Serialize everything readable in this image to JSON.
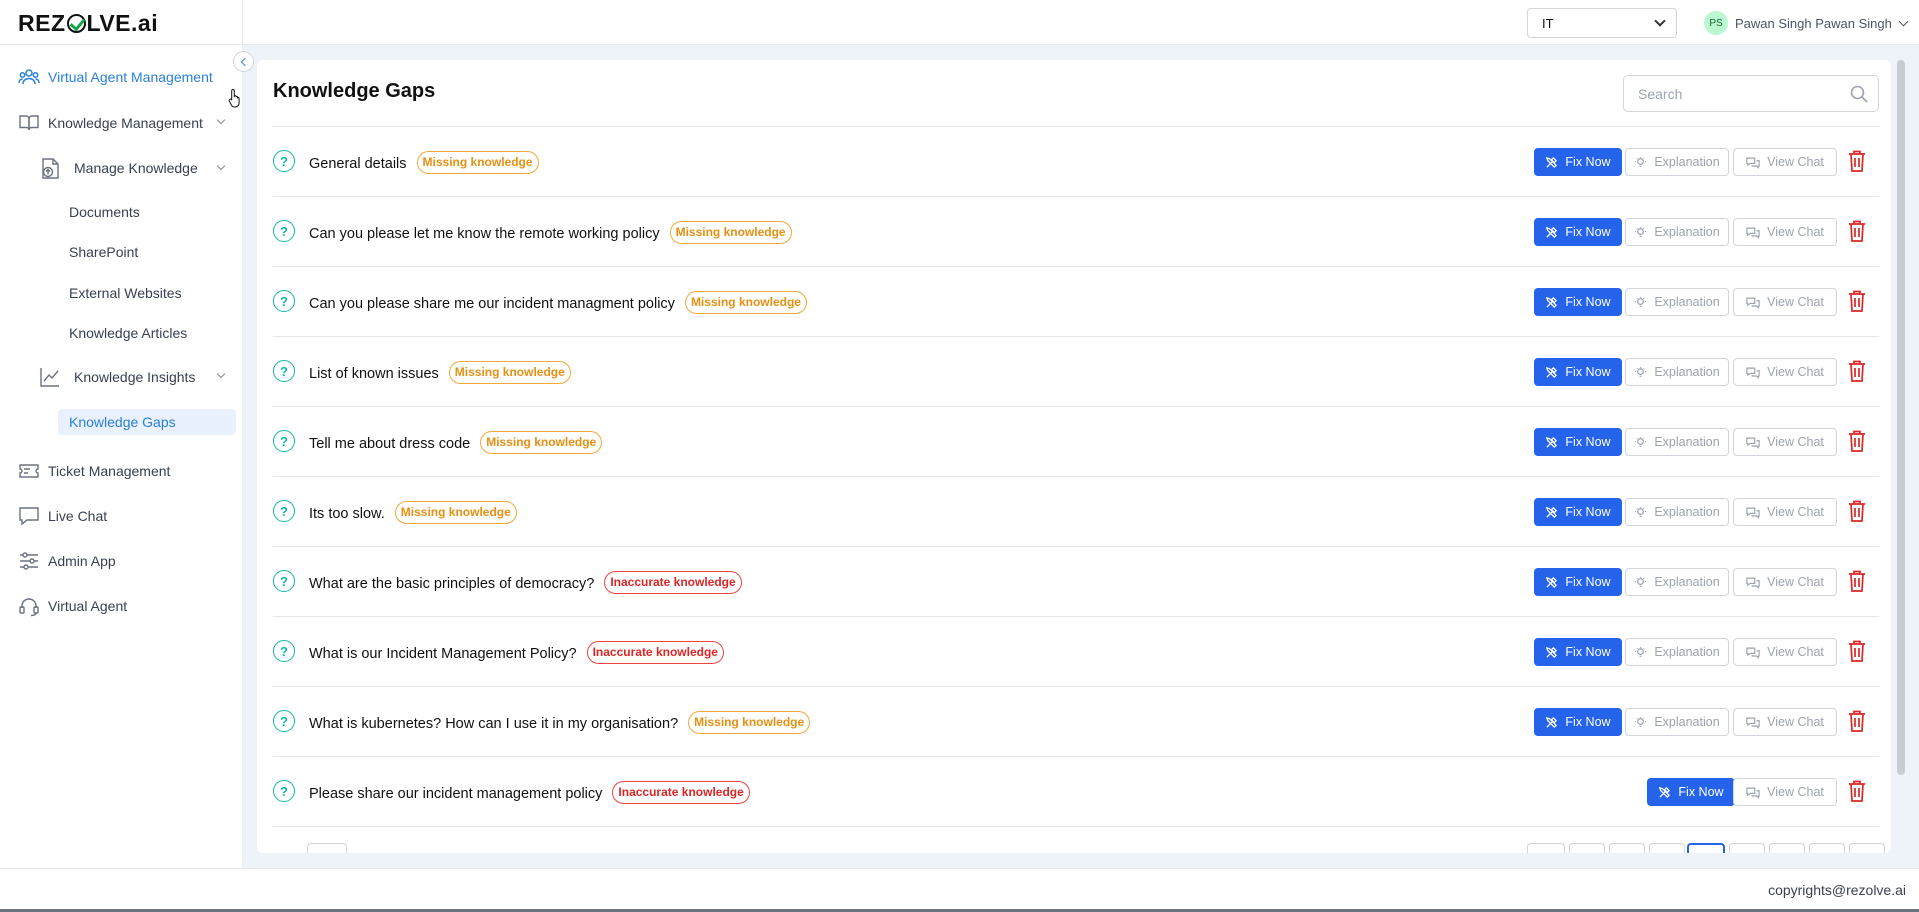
{
  "header": {
    "logo_text_before": "REZ",
    "logo_text_after": "LVE.ai",
    "department_select": "IT",
    "user_initials": "PS",
    "user_name": "Pawan Singh Pawan Singh"
  },
  "sidebar": {
    "items": [
      {
        "label": "Virtual Agent Management",
        "icon": "people-icon"
      },
      {
        "label": "Knowledge Management",
        "icon": "book-icon"
      },
      {
        "label": "Manage Knowledge",
        "icon": "file-upload-icon"
      },
      {
        "label": "Documents"
      },
      {
        "label": "SharePoint"
      },
      {
        "label": "External Websites"
      },
      {
        "label": "Knowledge Articles"
      },
      {
        "label": "Knowledge Insights",
        "icon": "chart-line-icon"
      },
      {
        "label": "Knowledge Gaps"
      },
      {
        "label": "Ticket Management",
        "icon": "ticket-icon"
      },
      {
        "label": "Live Chat",
        "icon": "chat-icon"
      },
      {
        "label": "Admin App",
        "icon": "sliders-icon"
      },
      {
        "label": "Virtual Agent",
        "icon": "headset-icon"
      }
    ]
  },
  "main": {
    "title": "Knowledge Gaps",
    "search_placeholder": "Search",
    "buttons": {
      "fix": "Fix Now",
      "explain": "Explanation",
      "chat": "View Chat"
    },
    "rows": [
      {
        "question": "General details",
        "badge": "Missing knowledge",
        "type": "missing"
      },
      {
        "question": "Can you please let me know the remote working policy",
        "badge": "Missing knowledge",
        "type": "missing"
      },
      {
        "question": "Can you please share me our incident managment policy",
        "badge": "Missing knowledge",
        "type": "missing"
      },
      {
        "question": "List of known issues",
        "badge": "Missing knowledge",
        "type": "missing"
      },
      {
        "question": "Tell me about dress code",
        "badge": "Missing knowledge",
        "type": "missing"
      },
      {
        "question": "Its too slow.",
        "badge": "Missing knowledge",
        "type": "missing"
      },
      {
        "question": "What are the basic principles of democracy?",
        "badge": "Inaccurate knowledge",
        "type": "inaccurate"
      },
      {
        "question": "What is our Incident Management Policy?",
        "badge": "Inaccurate knowledge",
        "type": "inaccurate"
      },
      {
        "question": "What is kubernetes? How can I use it in my organisation?",
        "badge": "Missing knowledge",
        "type": "missing"
      },
      {
        "question": "Please share our incident management policy",
        "badge": "Inaccurate knowledge",
        "type": "inaccurate"
      }
    ]
  },
  "footer": {
    "copyright": "copyrights@rezolve.ai"
  },
  "colors": {
    "accent": "#2563eb",
    "active_nav": "#2b80d9",
    "missing": "#e69013",
    "inaccurate": "#dc2626",
    "question_icon": "#14b8a6"
  }
}
